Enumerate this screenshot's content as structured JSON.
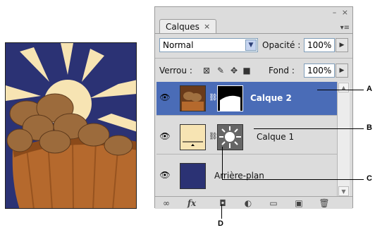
{
  "panel": {
    "window_controls": "– ×",
    "tab_label": "Calques",
    "tab_close": "×",
    "menu_icon": "▾≡",
    "blend_mode": "Normal",
    "opacity_label": "Opacité :",
    "opacity_value": "100%",
    "lock_label": "Verrou :",
    "fill_label": "Fond :",
    "fill_value": "100%",
    "layers": [
      {
        "name": "Calque 2",
        "selected": true
      },
      {
        "name": "Calque 1",
        "selected": false
      },
      {
        "name": "Arrière-plan",
        "selected": false
      }
    ],
    "bottom_icons": [
      "link-layers-icon",
      "fx-icon",
      "layer-mask-icon",
      "adjustment-layer-icon",
      "folder-icon",
      "new-layer-icon",
      "trash-icon"
    ],
    "fx_text": "fx"
  },
  "callouts": {
    "a": "A",
    "b": "B",
    "c": "C",
    "d": "D"
  },
  "colors": {
    "selected": "#4a6cb7",
    "photo_bg": "#2b3274",
    "sun": "#f7e4b3"
  }
}
